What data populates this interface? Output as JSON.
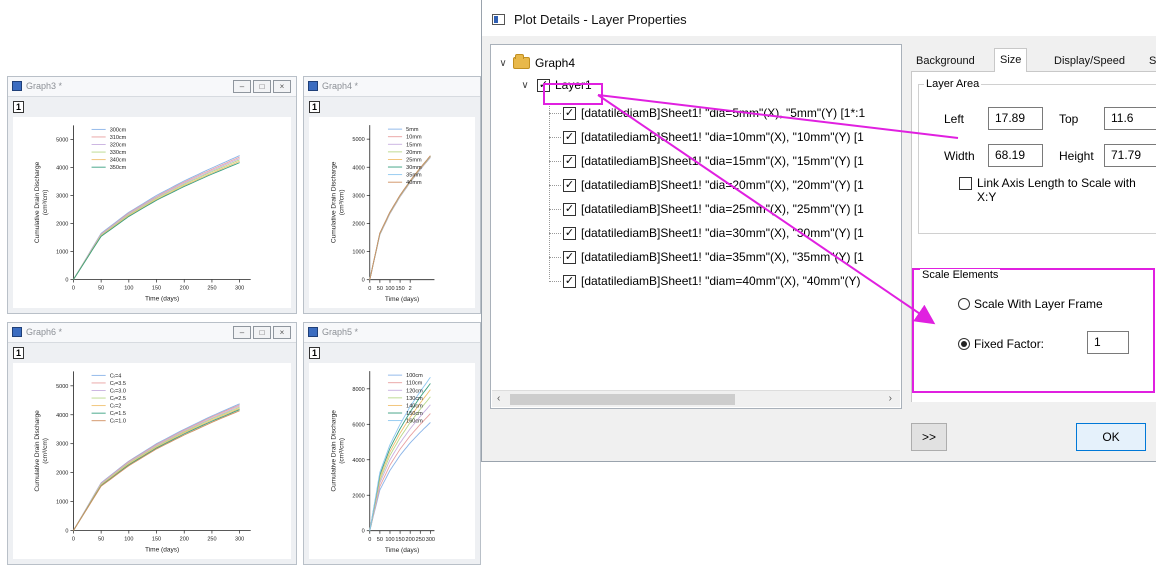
{
  "graphs": [
    {
      "id": "graph3",
      "window_title": "Graph3 *",
      "layer_label": "1",
      "ylabel": "Cumulative Drain Discharge",
      "yunit": "(cm³/cm)",
      "xlabel": "Time (days)",
      "yticks": [
        "0",
        "1000",
        "2000",
        "3000",
        "4000",
        "5000"
      ],
      "xticks": [
        "0",
        "50",
        "100",
        "150",
        "200",
        "250",
        "300"
      ],
      "legend": [
        "300cm",
        "310cm",
        "320cm",
        "330cm",
        "340cm",
        "350cm"
      ],
      "colors": [
        "#8ab4e8",
        "#e8a0a0",
        "#c8b0e0",
        "#b8d88a",
        "#f0c070",
        "#3aa080"
      ]
    },
    {
      "id": "graph4",
      "window_title": "Graph4 *",
      "layer_label": "1",
      "ylabel": "Cumulative Drain Discharge",
      "yunit": "(cm³/cm)",
      "xlabel": "Time (days)",
      "yticks": [
        "0",
        "1000",
        "2000",
        "3000",
        "4000",
        "5000"
      ],
      "xticks": [
        "0",
        "50",
        "100",
        "150",
        "2"
      ],
      "legend": [
        "5mm",
        "10mm",
        "15mm",
        "20mm",
        "25mm",
        "30mm",
        "35mm",
        "40mm"
      ],
      "colors": [
        "#8ab4e8",
        "#e8a0a0",
        "#c8b0e0",
        "#b8d88a",
        "#f0c070",
        "#3aa080",
        "#90c8f0",
        "#d09060"
      ]
    },
    {
      "id": "graph6",
      "window_title": "Graph6 *",
      "layer_label": "1",
      "ylabel": "Cumulative Drain Discharge",
      "yunit": "(cm³/cm)",
      "xlabel": "Time (days)",
      "yticks": [
        "0",
        "1000",
        "2000",
        "3000",
        "4000",
        "5000"
      ],
      "xticks": [
        "0",
        "50",
        "100",
        "150",
        "200",
        "250",
        "300"
      ],
      "legend": [
        "Cᵣ=4",
        "Cᵣ=3.5",
        "Cᵣ=3.0",
        "Cᵣ=2.5",
        "Cᵣ=2",
        "Cᵣ=1.5",
        "Cᵣ=1.0"
      ],
      "colors": [
        "#8ab4e8",
        "#e8a0a0",
        "#c8b0e0",
        "#b8d88a",
        "#f0c070",
        "#3aa080",
        "#d09060"
      ]
    },
    {
      "id": "graph5",
      "window_title": "Graph5 *",
      "layer_label": "1",
      "ylabel": "Cumulative Drain Discharge",
      "yunit": "(cm³/cm)",
      "xlabel": "Time (days)",
      "yticks": [
        "0",
        "2000",
        "4000",
        "6000",
        "8000"
      ],
      "xticks": [
        "0",
        "50",
        "100",
        "150",
        "200",
        "250",
        "300"
      ],
      "legend": [
        "100cm",
        "110cm",
        "120cm",
        "130cm",
        "140cm",
        "150cm",
        "160cm"
      ],
      "colors": [
        "#8ab4e8",
        "#e8a0a0",
        "#c8b0e0",
        "#b8d88a",
        "#f0c070",
        "#3aa080",
        "#90c8f0"
      ]
    }
  ],
  "chart_data": [
    {
      "type": "line",
      "title": "",
      "xlabel": "Time (days)",
      "ylabel": "Cumulative Drain Discharge (cm³/cm)",
      "xlim": [
        0,
        320
      ],
      "ylim": [
        0,
        5500
      ],
      "x": [
        0,
        50,
        100,
        150,
        200,
        250,
        300
      ],
      "series": [
        {
          "name": "300cm",
          "values": [
            0,
            1650,
            2400,
            3000,
            3520,
            3980,
            4420
          ]
        },
        {
          "name": "310cm",
          "values": [
            0,
            1620,
            2370,
            2960,
            3480,
            3930,
            4370
          ]
        },
        {
          "name": "320cm",
          "values": [
            0,
            1600,
            2340,
            2930,
            3440,
            3890,
            4320
          ]
        },
        {
          "name": "330cm",
          "values": [
            0,
            1580,
            2310,
            2900,
            3400,
            3850,
            4270
          ]
        },
        {
          "name": "340cm",
          "values": [
            0,
            1560,
            2280,
            2860,
            3360,
            3800,
            4220
          ]
        },
        {
          "name": "350cm",
          "values": [
            0,
            1540,
            2250,
            2830,
            3320,
            3760,
            4170
          ]
        }
      ]
    },
    {
      "type": "line",
      "title": "",
      "xlabel": "Time (days)",
      "ylabel": "Cumulative Drain Discharge (cm³/cm)",
      "xlim": [
        0,
        320
      ],
      "ylim": [
        0,
        5500
      ],
      "x": [
        0,
        50,
        100,
        150,
        200,
        250,
        300
      ],
      "series": [
        {
          "name": "5mm",
          "values": [
            0,
            1600,
            2350,
            2950,
            3460,
            3920,
            4350
          ]
        },
        {
          "name": "10mm",
          "values": [
            0,
            1610,
            2360,
            2960,
            3470,
            3930,
            4360
          ]
        },
        {
          "name": "15mm",
          "values": [
            0,
            1620,
            2370,
            2970,
            3480,
            3940,
            4370
          ]
        },
        {
          "name": "20mm",
          "values": [
            0,
            1630,
            2380,
            2980,
            3490,
            3950,
            4380
          ]
        },
        {
          "name": "25mm",
          "values": [
            0,
            1640,
            2390,
            2990,
            3500,
            3960,
            4390
          ]
        },
        {
          "name": "30mm",
          "values": [
            0,
            1650,
            2400,
            3000,
            3510,
            3970,
            4400
          ]
        },
        {
          "name": "35mm",
          "values": [
            0,
            1655,
            2405,
            3005,
            3515,
            3975,
            4405
          ]
        },
        {
          "name": "40mm",
          "values": [
            0,
            1660,
            2410,
            3010,
            3520,
            3980,
            4410
          ]
        }
      ]
    },
    {
      "type": "line",
      "title": "",
      "xlabel": "Time (days)",
      "ylabel": "Cumulative Drain Discharge (cm³/cm)",
      "xlim": [
        0,
        320
      ],
      "ylim": [
        0,
        5500
      ],
      "x": [
        0,
        50,
        100,
        150,
        200,
        250,
        300
      ],
      "series": [
        {
          "name": "Cᵣ=4",
          "values": [
            0,
            1650,
            2400,
            3000,
            3500,
            3960,
            4380
          ]
        },
        {
          "name": "Cᵣ=3.5",
          "values": [
            0,
            1630,
            2380,
            2970,
            3470,
            3930,
            4340
          ]
        },
        {
          "name": "Cᵣ=3.0",
          "values": [
            0,
            1610,
            2350,
            2940,
            3440,
            3890,
            4300
          ]
        },
        {
          "name": "Cᵣ=2.5",
          "values": [
            0,
            1590,
            2330,
            2910,
            3410,
            3860,
            4260
          ]
        },
        {
          "name": "Cᵣ=2",
          "values": [
            0,
            1570,
            2300,
            2880,
            3380,
            3820,
            4220
          ]
        },
        {
          "name": "Cᵣ=1.5",
          "values": [
            0,
            1550,
            2270,
            2850,
            3340,
            3780,
            4180
          ]
        },
        {
          "name": "Cᵣ=1.0",
          "values": [
            0,
            1530,
            2240,
            2820,
            3300,
            3740,
            4140
          ]
        }
      ]
    },
    {
      "type": "line",
      "title": "",
      "xlabel": "Time (days)",
      "ylabel": "Cumulative Drain Discharge (cm³/cm)",
      "xlim": [
        0,
        320
      ],
      "ylim": [
        0,
        9000
      ],
      "x": [
        0,
        50,
        100,
        150,
        200,
        250,
        300
      ],
      "series": [
        {
          "name": "100cm",
          "values": [
            0,
            2300,
            3400,
            4250,
            4950,
            5550,
            6100
          ]
        },
        {
          "name": "110cm",
          "values": [
            0,
            2500,
            3700,
            4600,
            5350,
            6000,
            6600
          ]
        },
        {
          "name": "120cm",
          "values": [
            0,
            2700,
            4000,
            4950,
            5750,
            6450,
            7100
          ]
        },
        {
          "name": "130cm",
          "values": [
            0,
            2850,
            4250,
            5250,
            6100,
            6850,
            7550
          ]
        },
        {
          "name": "140cm",
          "values": [
            0,
            3000,
            4450,
            5500,
            6400,
            7200,
            7950
          ]
        },
        {
          "name": "150cm",
          "values": [
            0,
            3150,
            4650,
            5750,
            6700,
            7550,
            8300
          ]
        },
        {
          "name": "160cm",
          "values": [
            0,
            3300,
            4850,
            6000,
            7000,
            7850,
            8650
          ]
        }
      ]
    }
  ],
  "dialog": {
    "title": "Plot Details - Layer Properties",
    "tree": {
      "root": "Graph4",
      "layer": "Layer1",
      "items": [
        "[datatilediamB]Sheet1! \"dia=5mm\"(X), \"5mm\"(Y) [1*:1",
        "[datatilediamB]Sheet1! \"dia=10mm\"(X), \"10mm\"(Y) [1",
        "[datatilediamB]Sheet1! \"dia=15mm\"(X), \"15mm\"(Y) [1",
        "[datatilediamB]Sheet1! \"dia=20mm\"(X), \"20mm\"(Y) [1",
        "[datatilediamB]Sheet1! \"dia=25mm\"(X), \"25mm\"(Y) [1",
        "[datatilediamB]Sheet1! \"dia=30mm\"(X), \"30mm\"(Y) [1",
        "[datatilediamB]Sheet1! \"dia=35mm\"(X), \"35mm\"(Y) [1",
        "[datatilediamB]Sheet1! \"diam=40mm\"(X), \"40mm\"(Y)"
      ]
    },
    "tabs": [
      "Background",
      "Size",
      "Display/Speed",
      "S"
    ],
    "layer_area": {
      "group_title": "Layer Area",
      "left_label": "Left",
      "left_value": "17.89",
      "top_label": "Top",
      "top_value": "11.6",
      "width_label": "Width",
      "width_value": "68.19",
      "height_label": "Height",
      "height_value": "71.79",
      "link_label": "Link Axis Length to Scale with X:Y"
    },
    "scale_elements": {
      "group_title": "Scale Elements",
      "option1": "Scale With Layer Frame",
      "option2": "Fixed Factor:",
      "factor_value": "1",
      "selected": "Fixed Factor:"
    },
    "expand_label": ">>",
    "ok_label": "OK",
    "scroll_left": "‹",
    "scroll_right": "›"
  },
  "accent_color": "#e020e0"
}
